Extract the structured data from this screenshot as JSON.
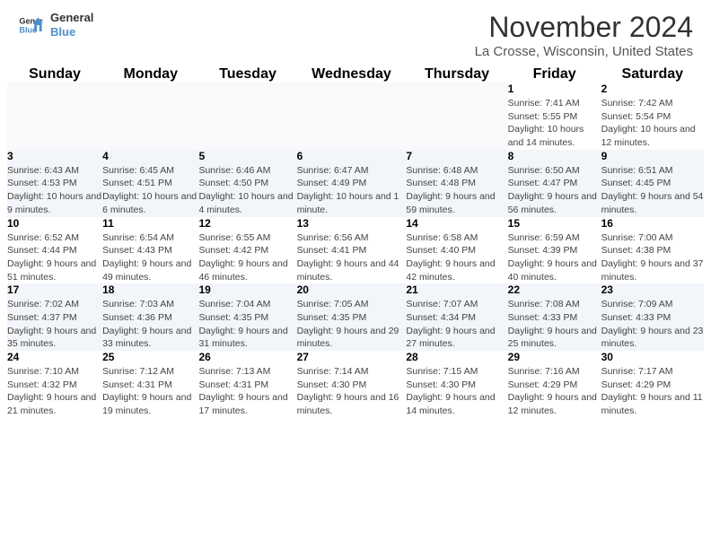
{
  "header": {
    "logo_line1": "General",
    "logo_line2": "Blue",
    "month_title": "November 2024",
    "location": "La Crosse, Wisconsin, United States"
  },
  "days_of_week": [
    "Sunday",
    "Monday",
    "Tuesday",
    "Wednesday",
    "Thursday",
    "Friday",
    "Saturday"
  ],
  "weeks": [
    {
      "row_bg": "white",
      "days": [
        {
          "date": "",
          "info": ""
        },
        {
          "date": "",
          "info": ""
        },
        {
          "date": "",
          "info": ""
        },
        {
          "date": "",
          "info": ""
        },
        {
          "date": "",
          "info": ""
        },
        {
          "date": "1",
          "info": "Sunrise: 7:41 AM\nSunset: 5:55 PM\nDaylight: 10 hours and 14 minutes."
        },
        {
          "date": "2",
          "info": "Sunrise: 7:42 AM\nSunset: 5:54 PM\nDaylight: 10 hours and 12 minutes."
        }
      ]
    },
    {
      "row_bg": "gray",
      "days": [
        {
          "date": "3",
          "info": "Sunrise: 6:43 AM\nSunset: 4:53 PM\nDaylight: 10 hours and 9 minutes."
        },
        {
          "date": "4",
          "info": "Sunrise: 6:45 AM\nSunset: 4:51 PM\nDaylight: 10 hours and 6 minutes."
        },
        {
          "date": "5",
          "info": "Sunrise: 6:46 AM\nSunset: 4:50 PM\nDaylight: 10 hours and 4 minutes."
        },
        {
          "date": "6",
          "info": "Sunrise: 6:47 AM\nSunset: 4:49 PM\nDaylight: 10 hours and 1 minute."
        },
        {
          "date": "7",
          "info": "Sunrise: 6:48 AM\nSunset: 4:48 PM\nDaylight: 9 hours and 59 minutes."
        },
        {
          "date": "8",
          "info": "Sunrise: 6:50 AM\nSunset: 4:47 PM\nDaylight: 9 hours and 56 minutes."
        },
        {
          "date": "9",
          "info": "Sunrise: 6:51 AM\nSunset: 4:45 PM\nDaylight: 9 hours and 54 minutes."
        }
      ]
    },
    {
      "row_bg": "white",
      "days": [
        {
          "date": "10",
          "info": "Sunrise: 6:52 AM\nSunset: 4:44 PM\nDaylight: 9 hours and 51 minutes."
        },
        {
          "date": "11",
          "info": "Sunrise: 6:54 AM\nSunset: 4:43 PM\nDaylight: 9 hours and 49 minutes."
        },
        {
          "date": "12",
          "info": "Sunrise: 6:55 AM\nSunset: 4:42 PM\nDaylight: 9 hours and 46 minutes."
        },
        {
          "date": "13",
          "info": "Sunrise: 6:56 AM\nSunset: 4:41 PM\nDaylight: 9 hours and 44 minutes."
        },
        {
          "date": "14",
          "info": "Sunrise: 6:58 AM\nSunset: 4:40 PM\nDaylight: 9 hours and 42 minutes."
        },
        {
          "date": "15",
          "info": "Sunrise: 6:59 AM\nSunset: 4:39 PM\nDaylight: 9 hours and 40 minutes."
        },
        {
          "date": "16",
          "info": "Sunrise: 7:00 AM\nSunset: 4:38 PM\nDaylight: 9 hours and 37 minutes."
        }
      ]
    },
    {
      "row_bg": "gray",
      "days": [
        {
          "date": "17",
          "info": "Sunrise: 7:02 AM\nSunset: 4:37 PM\nDaylight: 9 hours and 35 minutes."
        },
        {
          "date": "18",
          "info": "Sunrise: 7:03 AM\nSunset: 4:36 PM\nDaylight: 9 hours and 33 minutes."
        },
        {
          "date": "19",
          "info": "Sunrise: 7:04 AM\nSunset: 4:35 PM\nDaylight: 9 hours and 31 minutes."
        },
        {
          "date": "20",
          "info": "Sunrise: 7:05 AM\nSunset: 4:35 PM\nDaylight: 9 hours and 29 minutes."
        },
        {
          "date": "21",
          "info": "Sunrise: 7:07 AM\nSunset: 4:34 PM\nDaylight: 9 hours and 27 minutes."
        },
        {
          "date": "22",
          "info": "Sunrise: 7:08 AM\nSunset: 4:33 PM\nDaylight: 9 hours and 25 minutes."
        },
        {
          "date": "23",
          "info": "Sunrise: 7:09 AM\nSunset: 4:33 PM\nDaylight: 9 hours and 23 minutes."
        }
      ]
    },
    {
      "row_bg": "white",
      "days": [
        {
          "date": "24",
          "info": "Sunrise: 7:10 AM\nSunset: 4:32 PM\nDaylight: 9 hours and 21 minutes."
        },
        {
          "date": "25",
          "info": "Sunrise: 7:12 AM\nSunset: 4:31 PM\nDaylight: 9 hours and 19 minutes."
        },
        {
          "date": "26",
          "info": "Sunrise: 7:13 AM\nSunset: 4:31 PM\nDaylight: 9 hours and 17 minutes."
        },
        {
          "date": "27",
          "info": "Sunrise: 7:14 AM\nSunset: 4:30 PM\nDaylight: 9 hours and 16 minutes."
        },
        {
          "date": "28",
          "info": "Sunrise: 7:15 AM\nSunset: 4:30 PM\nDaylight: 9 hours and 14 minutes."
        },
        {
          "date": "29",
          "info": "Sunrise: 7:16 AM\nSunset: 4:29 PM\nDaylight: 9 hours and 12 minutes."
        },
        {
          "date": "30",
          "info": "Sunrise: 7:17 AM\nSunset: 4:29 PM\nDaylight: 9 hours and 11 minutes."
        }
      ]
    }
  ]
}
